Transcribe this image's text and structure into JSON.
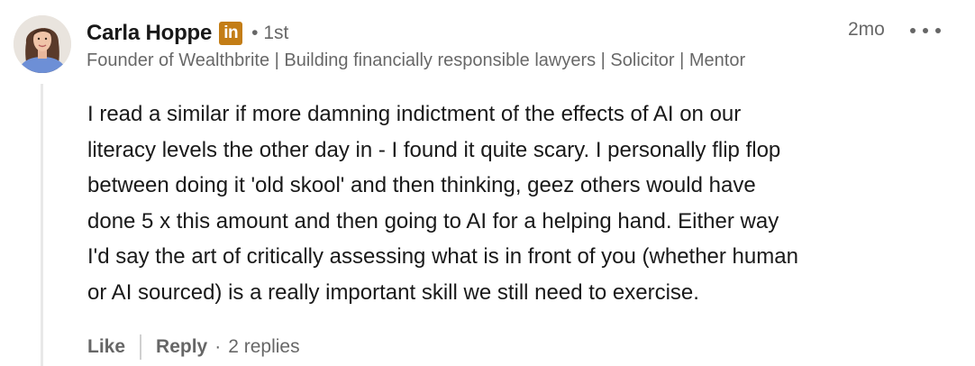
{
  "comment": {
    "author": {
      "name": "Carla Hoppe",
      "badge_icon": "linkedin-premium-icon",
      "badge_text": "in",
      "badge_color": "#c37d16",
      "connection_degree": "• 1st",
      "headline": "Founder of Wealthbrite | Building financially responsible lawyers | Solicitor | Mentor",
      "avatar_icon": "profile-photo"
    },
    "timestamp": "2mo",
    "more_icon": "more-options-icon",
    "text": "I read a similar if more damning indictment of the effects of AI on our\nliteracy levels the other day in - I found it quite scary. I personally flip flop\nbetween doing it 'old skool' and then thinking, geez others would have\ndone 5 x this amount and then going to AI for a helping hand. Either way\nI'd say the art of critically assessing what is in front of you (whether human\nor AI sourced) is a really important skill we still need to exercise."
  },
  "actions": {
    "like_label": "Like",
    "reply_label": "Reply",
    "separator": "·",
    "replies_label": "2 replies"
  }
}
